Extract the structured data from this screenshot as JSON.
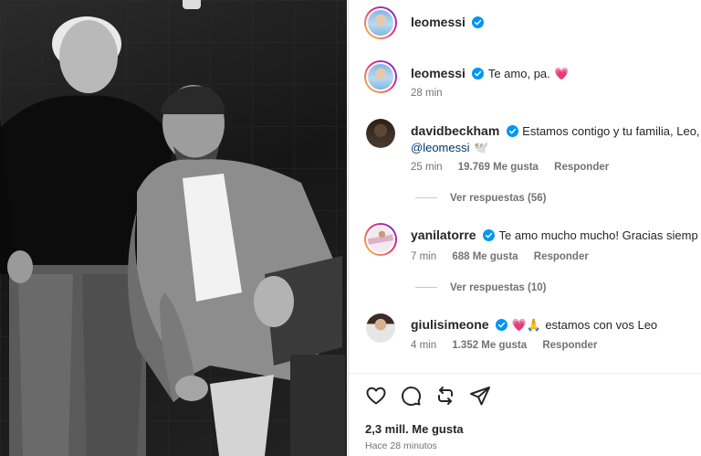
{
  "post": {
    "author": "leomessi",
    "verified": true
  },
  "caption": {
    "username": "leomessi",
    "text": "Te amo, pa.",
    "emoji": "💗",
    "time": "28 min"
  },
  "comments": [
    {
      "username": "davidbeckham",
      "text": "Estamos contigo y tu familia, Leo,",
      "mention": "@leomessi",
      "emoji": "🕊️",
      "time": "25 min",
      "likes": "19.769 Me gusta",
      "reply_label": "Responder",
      "view_replies": "Ver respuestas (56)"
    },
    {
      "username": "yanilatorre",
      "text": "Te amo mucho mucho! Gracias siemp",
      "time": "7 min",
      "likes": "688 Me gusta",
      "reply_label": "Responder",
      "view_replies": "Ver respuestas (10)"
    },
    {
      "username": "giulisimeone",
      "emoji": "💗🙏",
      "text": "estamos con vos Leo",
      "time": "4 min",
      "likes": "1.352 Me gusta",
      "reply_label": "Responder"
    }
  ],
  "actions": {
    "icons": [
      "heart-icon",
      "comment-icon",
      "repost-icon",
      "share-icon"
    ]
  },
  "stats": {
    "likes": "2,3 mill. Me gusta",
    "posted": "Hace 28 minutos"
  },
  "colors": {
    "verified_blue": "#0095f6",
    "meta_gray": "#737373",
    "mention_blue": "#00376b"
  }
}
